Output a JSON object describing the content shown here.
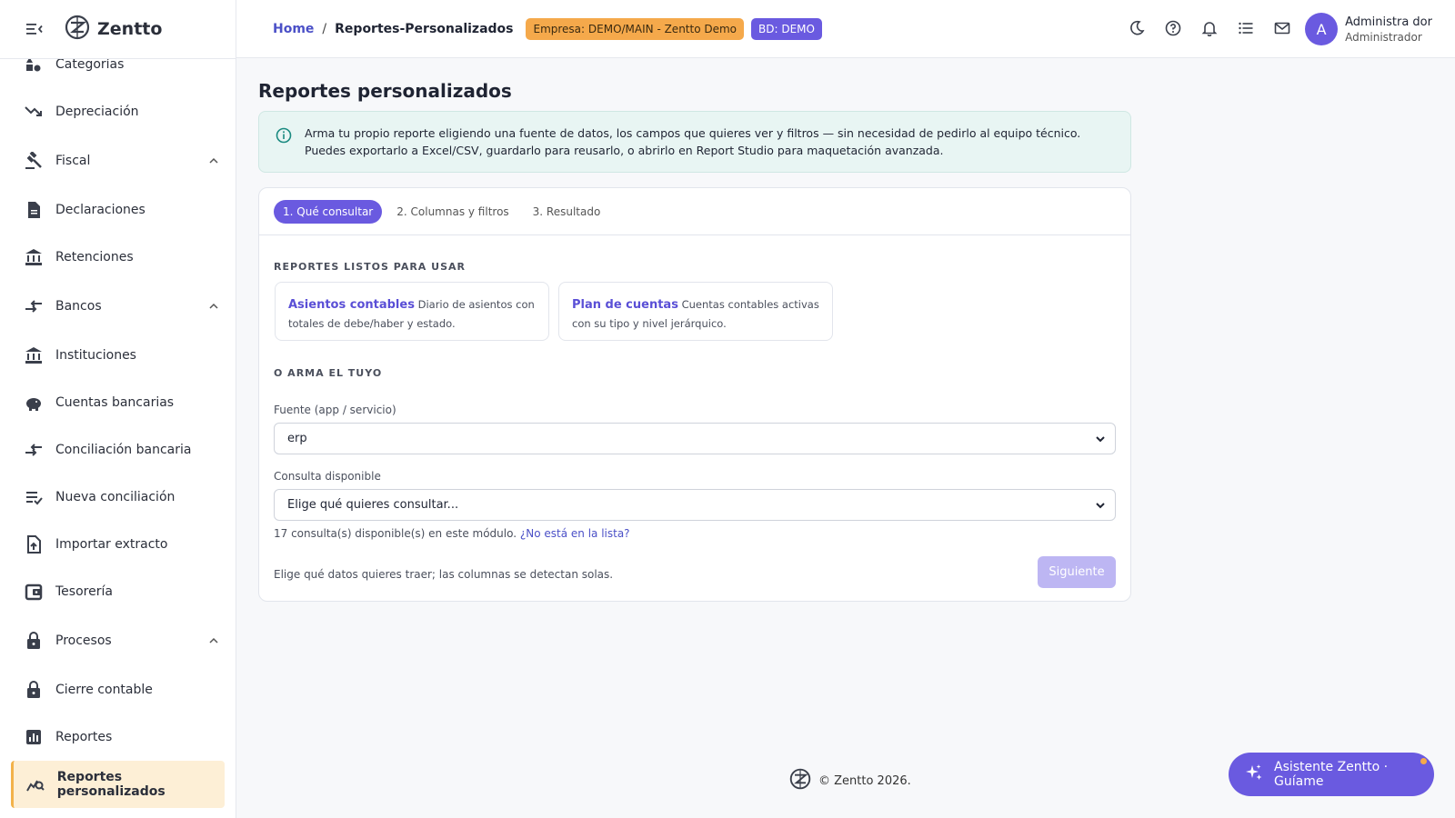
{
  "app": {
    "name": "Zentto"
  },
  "sidebar": {
    "items": [
      {
        "label": "Categorías",
        "icon": "category-icon"
      },
      {
        "label": "Depreciación",
        "icon": "trending-down-icon"
      },
      {
        "label": "Fiscal",
        "icon": "gavel-icon",
        "group": true
      },
      {
        "label": "Declaraciones",
        "icon": "document-icon"
      },
      {
        "label": "Retenciones",
        "icon": "bank-icon"
      },
      {
        "label": "Bancos",
        "icon": "transfer-icon",
        "group": true
      },
      {
        "label": "Instituciones",
        "icon": "bank-icon"
      },
      {
        "label": "Cuentas bancarias",
        "icon": "piggy-bank-icon"
      },
      {
        "label": "Conciliación bancaria",
        "icon": "transfer-icon"
      },
      {
        "label": "Nueva conciliación",
        "icon": "playlist-check-icon"
      },
      {
        "label": "Importar extracto",
        "icon": "file-upload-icon"
      },
      {
        "label": "Tesorería",
        "icon": "wallet-icon"
      },
      {
        "label": "Procesos",
        "icon": "lock-icon",
        "group": true
      },
      {
        "label": "Cierre contable",
        "icon": "lock-icon"
      },
      {
        "label": "Reportes",
        "icon": "bar-chart-icon"
      },
      {
        "label": "Reportes personalizados",
        "icon": "query-stats-icon",
        "active": true
      }
    ]
  },
  "topbar": {
    "breadcrumb_home": "Home",
    "breadcrumb_sep": "/",
    "breadcrumb_current": "Reportes-Personalizados",
    "company_badge": "Empresa: DEMO/MAIN - Zentto Demo",
    "db_badge": "BD: DEMO",
    "user": {
      "initial": "A",
      "name": "Administra dor",
      "role": "Administrador"
    }
  },
  "main": {
    "title": "Reportes personalizados",
    "info": "Arma tu propio reporte eligiendo una fuente de datos, los campos que quieres ver y filtros — sin necesidad de pedirlo al equipo técnico. Puedes exportarlo a Excel/CSV, guardarlo para reusarlo, o abrirlo en Report Studio para maquetación avanzada.",
    "tabs": [
      {
        "label": "1. Qué consultar",
        "active": true
      },
      {
        "label": "2. Columnas y filtros"
      },
      {
        "label": "3. Resultado"
      }
    ],
    "ready_section": "REPORTES LISTOS PARA USAR",
    "templates": [
      {
        "title": "Asientos contables",
        "desc": "Diario de asientos con totales de debe/haber y estado."
      },
      {
        "title": "Plan de cuentas",
        "desc": "Cuentas contables activas con su tipo y nivel jerárquico."
      }
    ],
    "custom_section": "O ARMA EL TUYO",
    "source_label": "Fuente (app / servicio)",
    "source_value": "erp",
    "query_label": "Consulta disponible",
    "query_value": "Elige qué quieres consultar...",
    "query_hint": "17 consulta(s) disponible(s) en este módulo.",
    "query_hint_link": "¿No está en la lista?",
    "footer_hint": "Elige qué datos quieres traer; las columnas se detectan solas.",
    "next_button": "Siguiente"
  },
  "footer": {
    "text": "© Zentto 2026."
  },
  "assistant": {
    "label": "Asistente Zentto · Guíame"
  },
  "colors": {
    "accent": "#6a5ae0",
    "warning": "#f5a94b",
    "info_bg": "#e8f5f3",
    "active_item": "#fdefd6"
  }
}
